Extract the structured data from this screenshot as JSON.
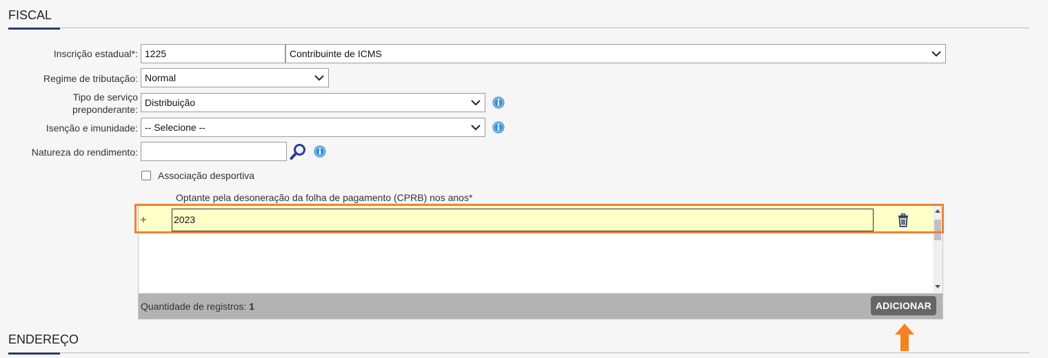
{
  "fiscal_section": {
    "title": "FISCAL"
  },
  "form": {
    "inscricao_label": "Inscrição estadual*:",
    "inscricao_value": "1225",
    "contribuinte_value": "Contribuinte de ICMS",
    "regime_label": "Regime de tributação:",
    "regime_value": "Normal",
    "tipo_servico_label_line1": "Tipo de serviço",
    "tipo_servico_label_line2": "preponderante:",
    "tipo_servico_value": "Distribuição",
    "isencao_label": "Isenção e imunidade:",
    "isencao_value": "-- Selecione --",
    "natureza_label": "Natureza do rendimento:",
    "natureza_value": "",
    "associacao_label": "Associação desportiva",
    "associacao_checked": false
  },
  "cprb_grid": {
    "title": "Optante pela desoneração da folha de pagamento (CPRB) nos anos*",
    "rows": [
      {
        "year": "2023"
      }
    ],
    "count_label": "Quantidade de registros:",
    "count_value": "1",
    "add_label": "ADICIONAR"
  },
  "endereco_section": {
    "title": "ENDEREÇO"
  },
  "colors": {
    "accent": "#2b3a6b",
    "highlight": "#f08234",
    "row_bg": "#ffffc8",
    "info_icon": "#3a8fd6"
  }
}
